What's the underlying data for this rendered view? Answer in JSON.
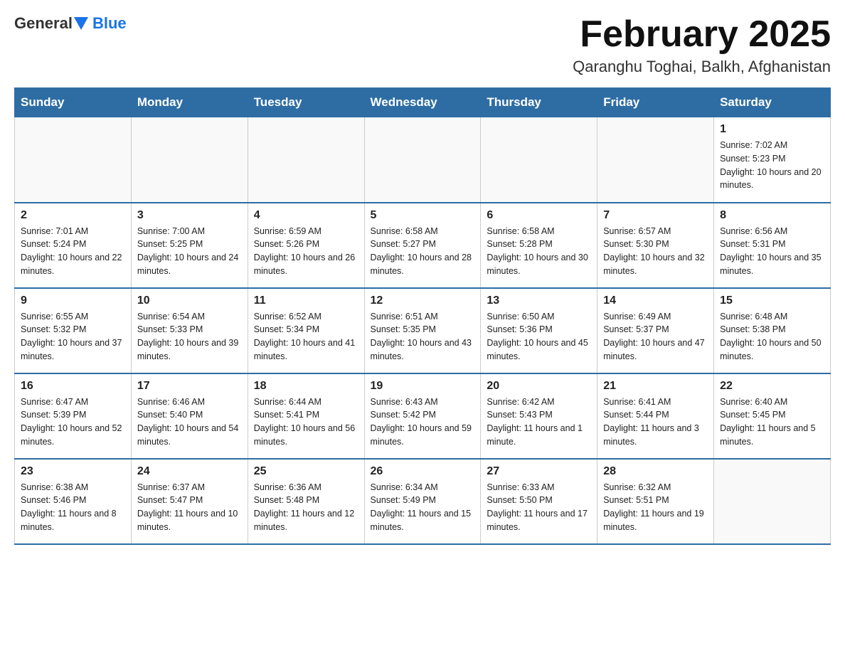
{
  "header": {
    "logo_general": "General",
    "logo_blue": "Blue",
    "month_title": "February 2025",
    "location": "Qaranghu Toghai, Balkh, Afghanistan"
  },
  "days_of_week": [
    "Sunday",
    "Monday",
    "Tuesday",
    "Wednesday",
    "Thursday",
    "Friday",
    "Saturday"
  ],
  "weeks": [
    [
      {
        "day": "",
        "info": ""
      },
      {
        "day": "",
        "info": ""
      },
      {
        "day": "",
        "info": ""
      },
      {
        "day": "",
        "info": ""
      },
      {
        "day": "",
        "info": ""
      },
      {
        "day": "",
        "info": ""
      },
      {
        "day": "1",
        "info": "Sunrise: 7:02 AM\nSunset: 5:23 PM\nDaylight: 10 hours and 20 minutes."
      }
    ],
    [
      {
        "day": "2",
        "info": "Sunrise: 7:01 AM\nSunset: 5:24 PM\nDaylight: 10 hours and 22 minutes."
      },
      {
        "day": "3",
        "info": "Sunrise: 7:00 AM\nSunset: 5:25 PM\nDaylight: 10 hours and 24 minutes."
      },
      {
        "day": "4",
        "info": "Sunrise: 6:59 AM\nSunset: 5:26 PM\nDaylight: 10 hours and 26 minutes."
      },
      {
        "day": "5",
        "info": "Sunrise: 6:58 AM\nSunset: 5:27 PM\nDaylight: 10 hours and 28 minutes."
      },
      {
        "day": "6",
        "info": "Sunrise: 6:58 AM\nSunset: 5:28 PM\nDaylight: 10 hours and 30 minutes."
      },
      {
        "day": "7",
        "info": "Sunrise: 6:57 AM\nSunset: 5:30 PM\nDaylight: 10 hours and 32 minutes."
      },
      {
        "day": "8",
        "info": "Sunrise: 6:56 AM\nSunset: 5:31 PM\nDaylight: 10 hours and 35 minutes."
      }
    ],
    [
      {
        "day": "9",
        "info": "Sunrise: 6:55 AM\nSunset: 5:32 PM\nDaylight: 10 hours and 37 minutes."
      },
      {
        "day": "10",
        "info": "Sunrise: 6:54 AM\nSunset: 5:33 PM\nDaylight: 10 hours and 39 minutes."
      },
      {
        "day": "11",
        "info": "Sunrise: 6:52 AM\nSunset: 5:34 PM\nDaylight: 10 hours and 41 minutes."
      },
      {
        "day": "12",
        "info": "Sunrise: 6:51 AM\nSunset: 5:35 PM\nDaylight: 10 hours and 43 minutes."
      },
      {
        "day": "13",
        "info": "Sunrise: 6:50 AM\nSunset: 5:36 PM\nDaylight: 10 hours and 45 minutes."
      },
      {
        "day": "14",
        "info": "Sunrise: 6:49 AM\nSunset: 5:37 PM\nDaylight: 10 hours and 47 minutes."
      },
      {
        "day": "15",
        "info": "Sunrise: 6:48 AM\nSunset: 5:38 PM\nDaylight: 10 hours and 50 minutes."
      }
    ],
    [
      {
        "day": "16",
        "info": "Sunrise: 6:47 AM\nSunset: 5:39 PM\nDaylight: 10 hours and 52 minutes."
      },
      {
        "day": "17",
        "info": "Sunrise: 6:46 AM\nSunset: 5:40 PM\nDaylight: 10 hours and 54 minutes."
      },
      {
        "day": "18",
        "info": "Sunrise: 6:44 AM\nSunset: 5:41 PM\nDaylight: 10 hours and 56 minutes."
      },
      {
        "day": "19",
        "info": "Sunrise: 6:43 AM\nSunset: 5:42 PM\nDaylight: 10 hours and 59 minutes."
      },
      {
        "day": "20",
        "info": "Sunrise: 6:42 AM\nSunset: 5:43 PM\nDaylight: 11 hours and 1 minute."
      },
      {
        "day": "21",
        "info": "Sunrise: 6:41 AM\nSunset: 5:44 PM\nDaylight: 11 hours and 3 minutes."
      },
      {
        "day": "22",
        "info": "Sunrise: 6:40 AM\nSunset: 5:45 PM\nDaylight: 11 hours and 5 minutes."
      }
    ],
    [
      {
        "day": "23",
        "info": "Sunrise: 6:38 AM\nSunset: 5:46 PM\nDaylight: 11 hours and 8 minutes."
      },
      {
        "day": "24",
        "info": "Sunrise: 6:37 AM\nSunset: 5:47 PM\nDaylight: 11 hours and 10 minutes."
      },
      {
        "day": "25",
        "info": "Sunrise: 6:36 AM\nSunset: 5:48 PM\nDaylight: 11 hours and 12 minutes."
      },
      {
        "day": "26",
        "info": "Sunrise: 6:34 AM\nSunset: 5:49 PM\nDaylight: 11 hours and 15 minutes."
      },
      {
        "day": "27",
        "info": "Sunrise: 6:33 AM\nSunset: 5:50 PM\nDaylight: 11 hours and 17 minutes."
      },
      {
        "day": "28",
        "info": "Sunrise: 6:32 AM\nSunset: 5:51 PM\nDaylight: 11 hours and 19 minutes."
      },
      {
        "day": "",
        "info": ""
      }
    ]
  ]
}
